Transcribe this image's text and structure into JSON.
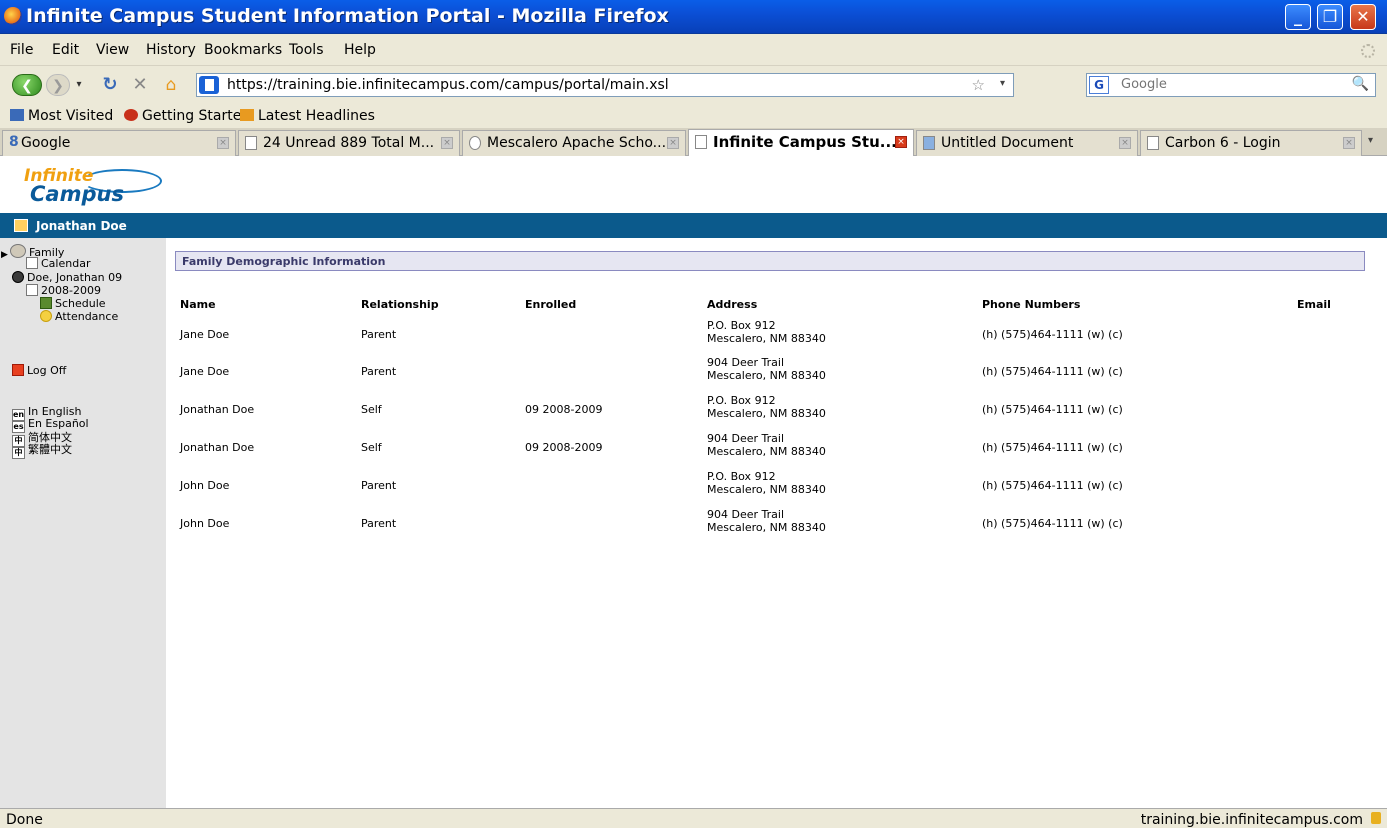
{
  "window": {
    "title": "Infinite Campus Student Information Portal - Mozilla Firefox",
    "controls": {
      "minimize": "_",
      "maximize": "❐",
      "close": "✕"
    }
  },
  "menu": [
    "File",
    "Edit",
    "View",
    "History",
    "Bookmarks",
    "Tools",
    "Help"
  ],
  "nav": {
    "url": "https://training.bie.infinitecampus.com/campus/portal/main.xsl",
    "search_placeholder": "Google"
  },
  "bookmarks": [
    "Most Visited",
    "Getting Started",
    "Latest Headlines"
  ],
  "tabs": [
    {
      "label": "Google",
      "active": false
    },
    {
      "label": "24 Unread 889 Total M...",
      "active": false
    },
    {
      "label": "Mescalero Apache Scho...",
      "active": false
    },
    {
      "label": "Infinite Campus Stu...",
      "active": true
    },
    {
      "label": "Untitled Document",
      "active": false
    },
    {
      "label": "Carbon 6 - Login",
      "active": false
    }
  ],
  "logo": {
    "line1": "Infinite",
    "line2": "Campus"
  },
  "user": {
    "name": "Jonathan Doe"
  },
  "sidebar": {
    "family": "Family",
    "calendar": "Calendar",
    "student": "Doe, Jonathan 09",
    "year": "2008-2009",
    "schedule": "Schedule",
    "attendance": "Attendance",
    "logoff": "Log Off",
    "languages": [
      {
        "code": "en",
        "label": "In English"
      },
      {
        "code": "es",
        "label": "En Español"
      },
      {
        "code": "中",
        "label": "简体中文"
      },
      {
        "code": "中",
        "label": "繁體中文"
      }
    ]
  },
  "section": {
    "title": "Family Demographic Information"
  },
  "table": {
    "headers": {
      "name": "Name",
      "relationship": "Relationship",
      "enrolled": "Enrolled",
      "address": "Address",
      "phone": "Phone Numbers",
      "email": "Email"
    },
    "rows": [
      {
        "name": "Jane Doe",
        "relationship": "Parent",
        "enrolled": "",
        "address1": "P.O. Box 912",
        "address2": "Mescalero, NM 88340",
        "phone": "(h) (575)464-1111 (w) (c)",
        "email": ""
      },
      {
        "name": "Jane Doe",
        "relationship": "Parent",
        "enrolled": "",
        "address1": "904 Deer Trail",
        "address2": "Mescalero, NM 88340",
        "phone": "(h) (575)464-1111 (w) (c)",
        "email": ""
      },
      {
        "name": "Jonathan Doe",
        "relationship": "Self",
        "enrolled": "09 2008-2009",
        "address1": "P.O. Box 912",
        "address2": "Mescalero, NM 88340",
        "phone": "(h) (575)464-1111 (w) (c)",
        "email": ""
      },
      {
        "name": "Jonathan Doe",
        "relationship": "Self",
        "enrolled": "09 2008-2009",
        "address1": "904 Deer Trail",
        "address2": "Mescalero, NM 88340",
        "phone": "(h) (575)464-1111 (w) (c)",
        "email": ""
      },
      {
        "name": "John Doe",
        "relationship": "Parent",
        "enrolled": "",
        "address1": "P.O. Box 912",
        "address2": "Mescalero, NM 88340",
        "phone": "(h) (575)464-1111 (w) (c)",
        "email": ""
      },
      {
        "name": "John Doe",
        "relationship": "Parent",
        "enrolled": "",
        "address1": "904 Deer Trail",
        "address2": "Mescalero, NM 88340",
        "phone": "(h) (575)464-1111 (w) (c)",
        "email": ""
      }
    ]
  },
  "status": {
    "text": "Done",
    "domain": "training.bie.infinitecampus.com"
  }
}
